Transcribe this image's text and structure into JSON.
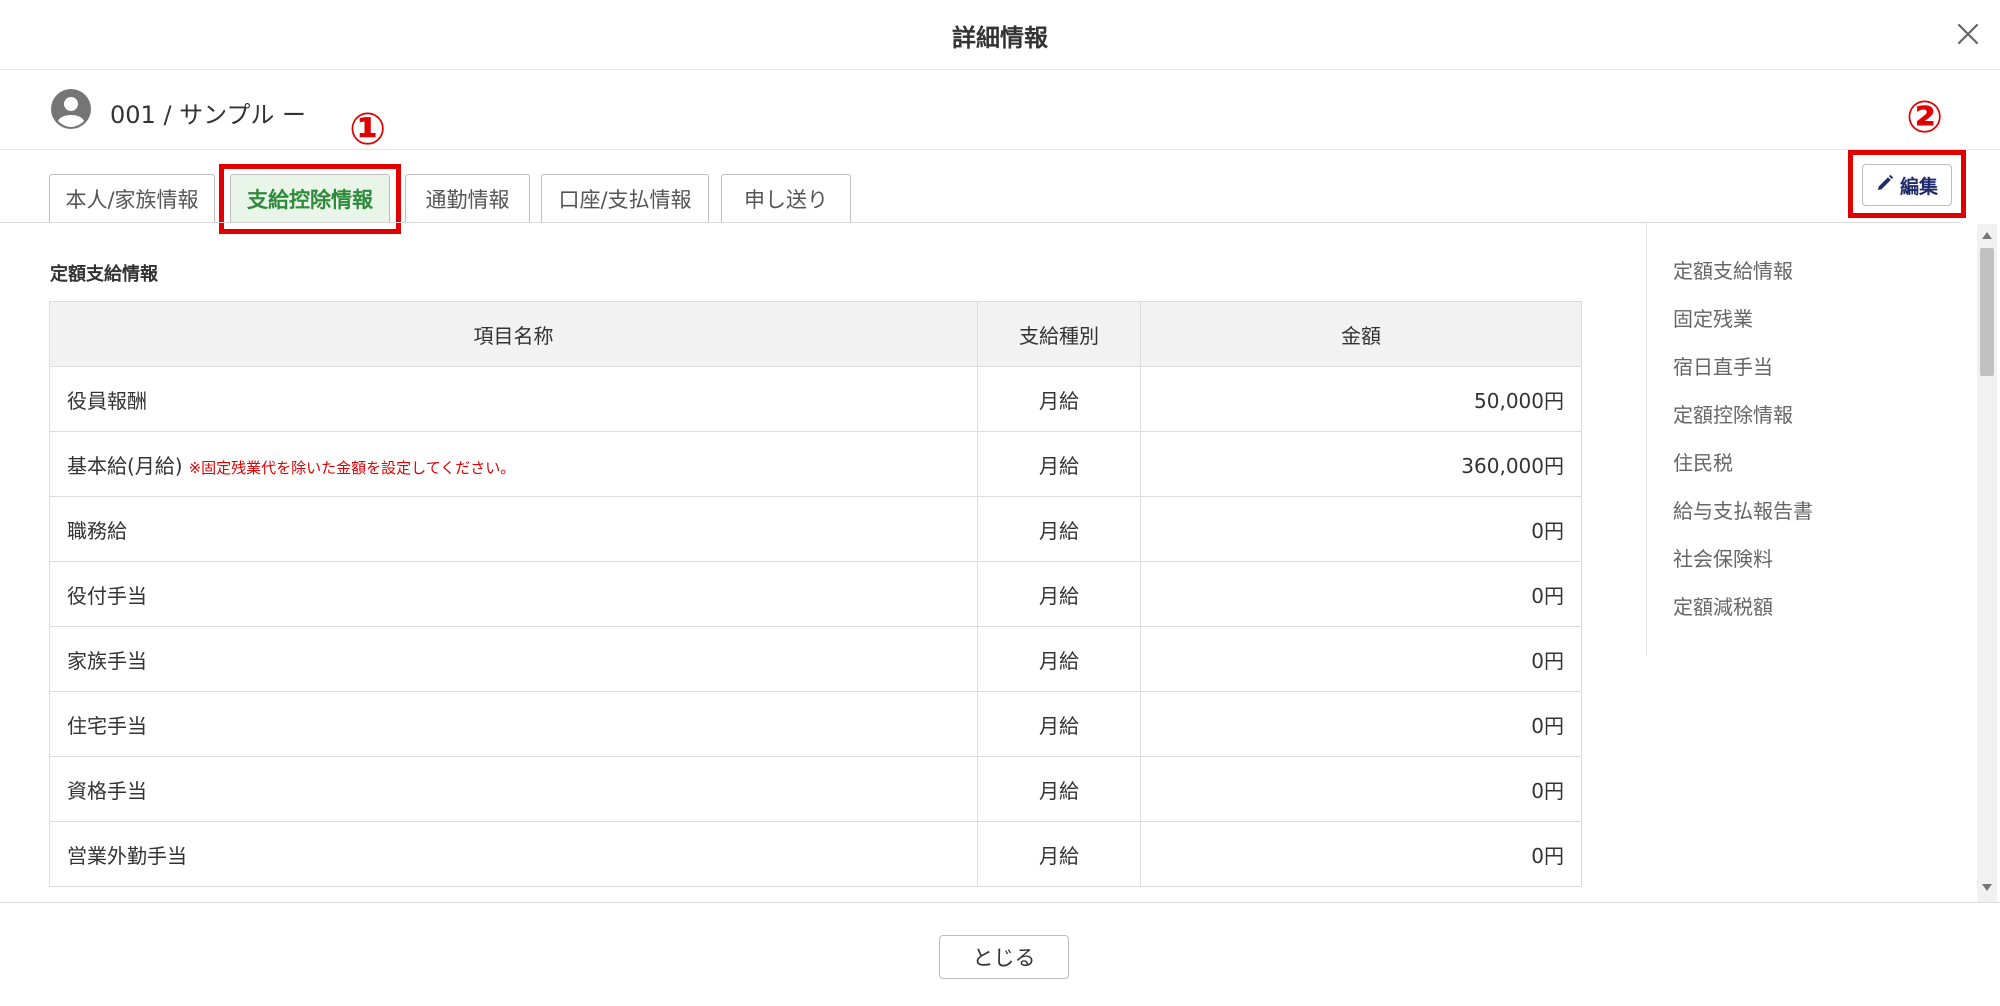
{
  "dialog": {
    "title": "詳細情報",
    "close_icon": "close-icon"
  },
  "user": {
    "avatar_icon": "user-avatar-icon",
    "name": "001 / サンプル ー"
  },
  "annotations": {
    "one": "①",
    "two": "②"
  },
  "tabs": [
    {
      "label": "本人/家族情報",
      "active": false
    },
    {
      "label": "支給控除情報",
      "active": true
    },
    {
      "label": "通勤情報",
      "active": false
    },
    {
      "label": "口座/支払情報",
      "active": false
    },
    {
      "label": "申し送り",
      "active": false
    }
  ],
  "edit_button": {
    "label": "編集",
    "icon": "pencil-icon"
  },
  "section": {
    "title": "定額支給情報"
  },
  "table": {
    "headers": [
      "項目名称",
      "支給種別",
      "金額"
    ],
    "rows": [
      {
        "name": "役員報酬",
        "note": "",
        "kind": "月給",
        "amount": "50,000円"
      },
      {
        "name": "基本給(月給)",
        "note": "※固定残業代を除いた金額を設定してください。",
        "kind": "月給",
        "amount": "360,000円"
      },
      {
        "name": "職務給",
        "note": "",
        "kind": "月給",
        "amount": "0円"
      },
      {
        "name": "役付手当",
        "note": "",
        "kind": "月給",
        "amount": "0円"
      },
      {
        "name": "家族手当",
        "note": "",
        "kind": "月給",
        "amount": "0円"
      },
      {
        "name": "住宅手当",
        "note": "",
        "kind": "月給",
        "amount": "0円"
      },
      {
        "name": "資格手当",
        "note": "",
        "kind": "月給",
        "amount": "0円"
      },
      {
        "name": "営業外勤手当",
        "note": "",
        "kind": "月給",
        "amount": "0円"
      }
    ]
  },
  "side_nav": [
    "定額支給情報",
    "固定残業",
    "宿日直手当",
    "定額控除情報",
    "住民税",
    "給与支払報告書",
    "社会保険料",
    "定額減税額"
  ],
  "footer": {
    "close_label": "とじる"
  },
  "colors": {
    "accent_red": "#e00000",
    "active_tab_green": "#2f8a3c",
    "edit_text_navy": "#1f2b6b"
  }
}
